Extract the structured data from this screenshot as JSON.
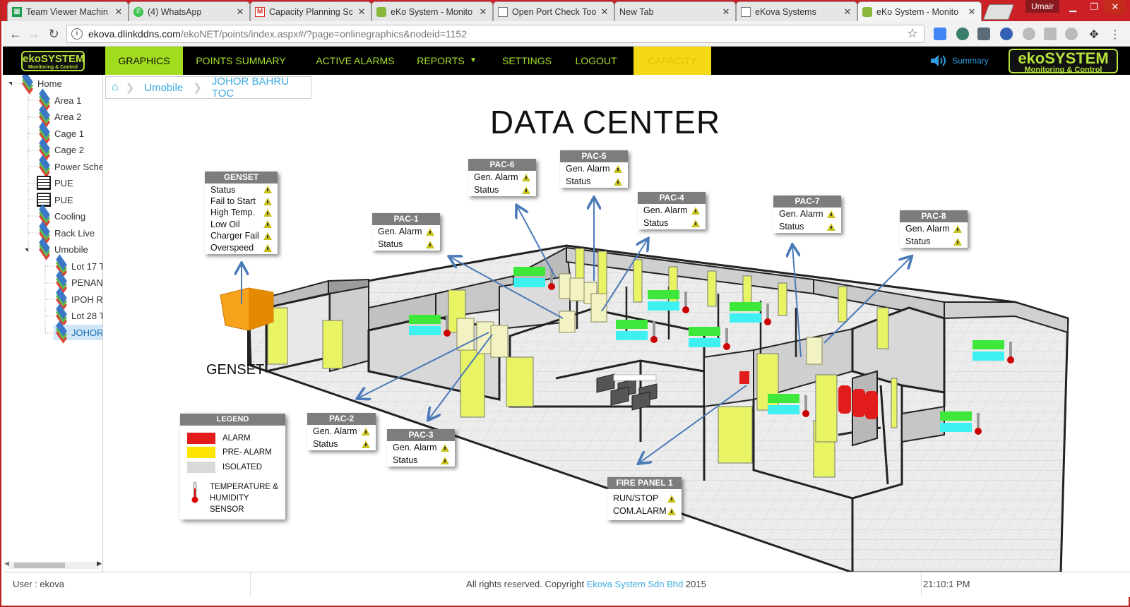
{
  "browser": {
    "tabs": [
      {
        "title": "Team Viewer Machin",
        "icon": "spreadsheet-icon",
        "active": false
      },
      {
        "title": "(4) WhatsApp",
        "icon": "whatsapp-icon",
        "active": false
      },
      {
        "title": "Capacity Planning Sc",
        "icon": "gmail-icon",
        "active": false
      },
      {
        "title": "eKo System - Monito",
        "icon": "ekosystem-icon",
        "active": false
      },
      {
        "title": "Open Port Check Too",
        "icon": "page-icon",
        "active": false
      },
      {
        "title": "New Tab",
        "icon": "",
        "active": false
      },
      {
        "title": "eKova Systems",
        "icon": "page-icon",
        "active": false
      },
      {
        "title": "eKo System - Monito",
        "icon": "ekosystem-icon",
        "active": true
      }
    ],
    "profile_name": "Umair",
    "url_host": "ekova.dlinkddns.com",
    "url_path": "/ekoNET/points/index.aspx#/?page=onlinegraphics&nodeid=1152"
  },
  "app": {
    "logo_main": "ekoSYSTEM",
    "logo_sub": "Monitoring & Control",
    "nav": [
      "GRAPHICS",
      "POINTS SUMMARY",
      "ACTIVE ALARMS",
      "REPORTS",
      "SETTINGS",
      "LOGOUT",
      "CAPACITY"
    ],
    "reports_caret": "▼",
    "summary_label": "Summary",
    "sidebar": {
      "items": [
        "Home",
        "Area 1",
        "Area 2",
        "Cage 1",
        "Cage 2",
        "Power Sche",
        "PUE",
        "PUE",
        "Cooling",
        "Rack Live",
        "Umobile",
        "Lot 17 T",
        "PENANG",
        "IPOH RN",
        "Lot 28 T",
        "JOHOR"
      ]
    },
    "breadcrumb": [
      "Umobile",
      "JOHOR BAHRU TOC"
    ]
  },
  "graphic": {
    "title": "DATA CENTER",
    "genset_label": "GENSET",
    "boxes": {
      "genset": {
        "title": "GENSET",
        "rows": [
          "Status",
          "Fail to Start",
          "High Temp.",
          "Low Oil",
          "Charger Fail",
          "Overspeed"
        ]
      },
      "pac1": {
        "title": "PAC-1",
        "rows": [
          "Gen. Alarm",
          "Status"
        ]
      },
      "pac2": {
        "title": "PAC-2",
        "rows": [
          "Gen. Alarm",
          "Status"
        ]
      },
      "pac3": {
        "title": "PAC-3",
        "rows": [
          "Gen. Alarm",
          "Status"
        ]
      },
      "pac4": {
        "title": "PAC-4",
        "rows": [
          "Gen. Alarm",
          "Status"
        ]
      },
      "pac5": {
        "title": "PAC-5",
        "rows": [
          "Gen. Alarm",
          "Status"
        ]
      },
      "pac6": {
        "title": "PAC-6",
        "rows": [
          "Gen. Alarm",
          "Status"
        ]
      },
      "pac7": {
        "title": "PAC-7",
        "rows": [
          "Gen. Alarm",
          "Status"
        ]
      },
      "pac8": {
        "title": "PAC-8",
        "rows": [
          "Gen. Alarm",
          "Status"
        ]
      },
      "fire": {
        "title": "FIRE PANEL 1",
        "rows": [
          "RUN/STOP",
          "COM.ALARM"
        ]
      }
    },
    "legend": {
      "title": "LEGEND",
      "items": [
        {
          "label": "ALARM",
          "color": "#e21b1b"
        },
        {
          "label": "PRE- ALARM",
          "color": "#ffe400"
        },
        {
          "label": "ISOLATED",
          "color": "#d9d9d9"
        }
      ],
      "sensor_line1": "TEMPERATURE &",
      "sensor_line2": "HUMIDITY SENSOR"
    },
    "colors": {
      "warning": "#c8c21a",
      "temp_bar": "#3ee83a",
      "humidity_bar": "#3ff0f0",
      "door": "#e8f463"
    }
  },
  "footer": {
    "user": "User : ekova",
    "copyright_pre": "All rights reserved. Copyright ",
    "copyright_link": "Ekova System Sdn Bhd",
    "copyright_post": " 2015",
    "time": "21:10:1 PM"
  }
}
